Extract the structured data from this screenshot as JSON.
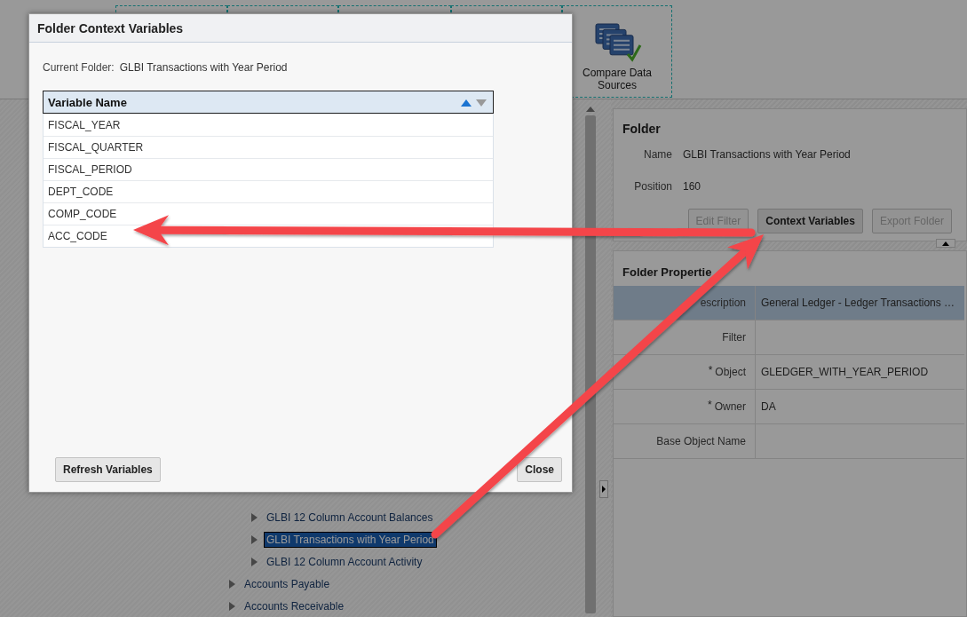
{
  "toolbar": {
    "tiles": [
      {
        "label": "Compare Data Sources"
      }
    ]
  },
  "tree": {
    "items": [
      {
        "children": [
          {
            "label": "GLBI 12 Column Account Balances",
            "selected": false
          },
          {
            "label": "GLBI Transactions with Year Period",
            "selected": true
          },
          {
            "label": "GLBI 12 Column Account Activity",
            "selected": false
          }
        ]
      },
      {
        "label": "Accounts Payable",
        "selected": false
      },
      {
        "label": "Accounts Receivable",
        "selected": false
      }
    ]
  },
  "folder": {
    "title": "Folder",
    "fields": [
      {
        "label": "Name",
        "value": "GLBI Transactions with Year Period"
      },
      {
        "label": "Position",
        "value": "160"
      }
    ],
    "buttons": [
      {
        "label": "Edit Filter",
        "disabled": true
      },
      {
        "label": "Context Variables",
        "disabled": false
      },
      {
        "label": "Export Folder",
        "disabled": true
      }
    ]
  },
  "folder_properties": {
    "title": "Folder Propertie",
    "rows": [
      {
        "label": "escription",
        "value": "General Ledger - Ledger Transactions …",
        "selected": true
      },
      {
        "label": "Filter",
        "selected": false
      },
      {
        "label": "Object",
        "value": "GLEDGER_WITH_YEAR_PERIOD",
        "required_mark": "*",
        "selected": false
      },
      {
        "label": "Owner",
        "value": "DA",
        "required_mark": "*",
        "selected": false
      },
      {
        "label": "Base Object Name",
        "selected": false
      }
    ]
  },
  "dialog": {
    "title": "Folder Context Variables",
    "current_folder_label": "Current Folder:",
    "current_folder": "GLBI Transactions with Year Period",
    "table": {
      "column": "Variable Name",
      "rows": [
        "FISCAL_YEAR",
        "FISCAL_QUARTER",
        "FISCAL_PERIOD",
        "DEPT_CODE",
        "COMP_CODE",
        "ACC_CODE"
      ]
    },
    "buttons": [
      "Refresh Variables",
      "Close"
    ]
  }
}
